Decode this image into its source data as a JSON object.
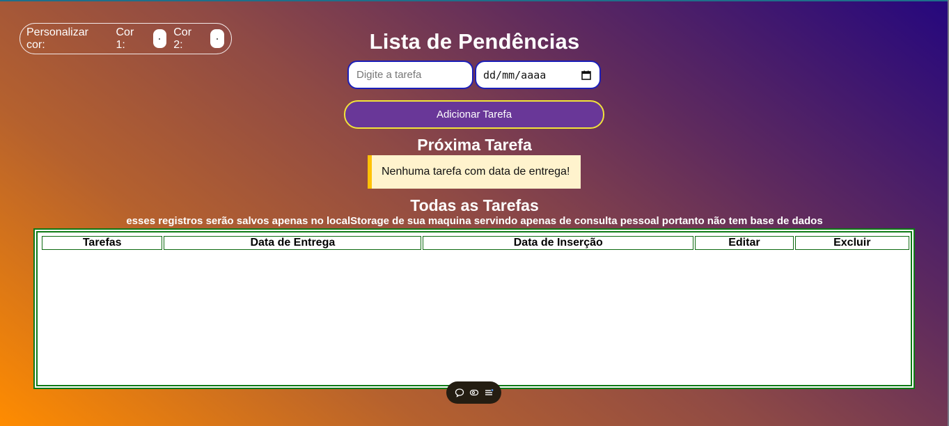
{
  "picker": {
    "label": "Personalizar cor:",
    "color1_label": "Cor 1:",
    "color2_label": "Cor 2:"
  },
  "title": "Lista de Pendências",
  "form": {
    "task_placeholder": "Digite a tarefa",
    "date_placeholder": "dd/mm/aaaa",
    "add_button": "Adicionar Tarefa"
  },
  "next_task": {
    "heading": "Próxima Tarefa",
    "message": "Nenhuma tarefa com data de entrega!"
  },
  "all_tasks": {
    "heading": "Todas as Tarefas",
    "note": "esses registros serão salvos apenas no localStorage de sua maquina servindo apenas de consulta pessoal portanto não tem base de dados",
    "columns": [
      "Tarefas",
      "Data de Entrega",
      "Data de Inserção",
      "Editar",
      "Excluir"
    ]
  },
  "toolbar": {
    "icons": [
      "chat-icon",
      "eye-icon",
      "menu-icon"
    ]
  },
  "colors": {
    "accent": "#693798",
    "button_border": "#f2e43a",
    "table_border": "#0d7a15",
    "notice_bg": "#fff3cd",
    "notice_border": "#ffc107"
  }
}
